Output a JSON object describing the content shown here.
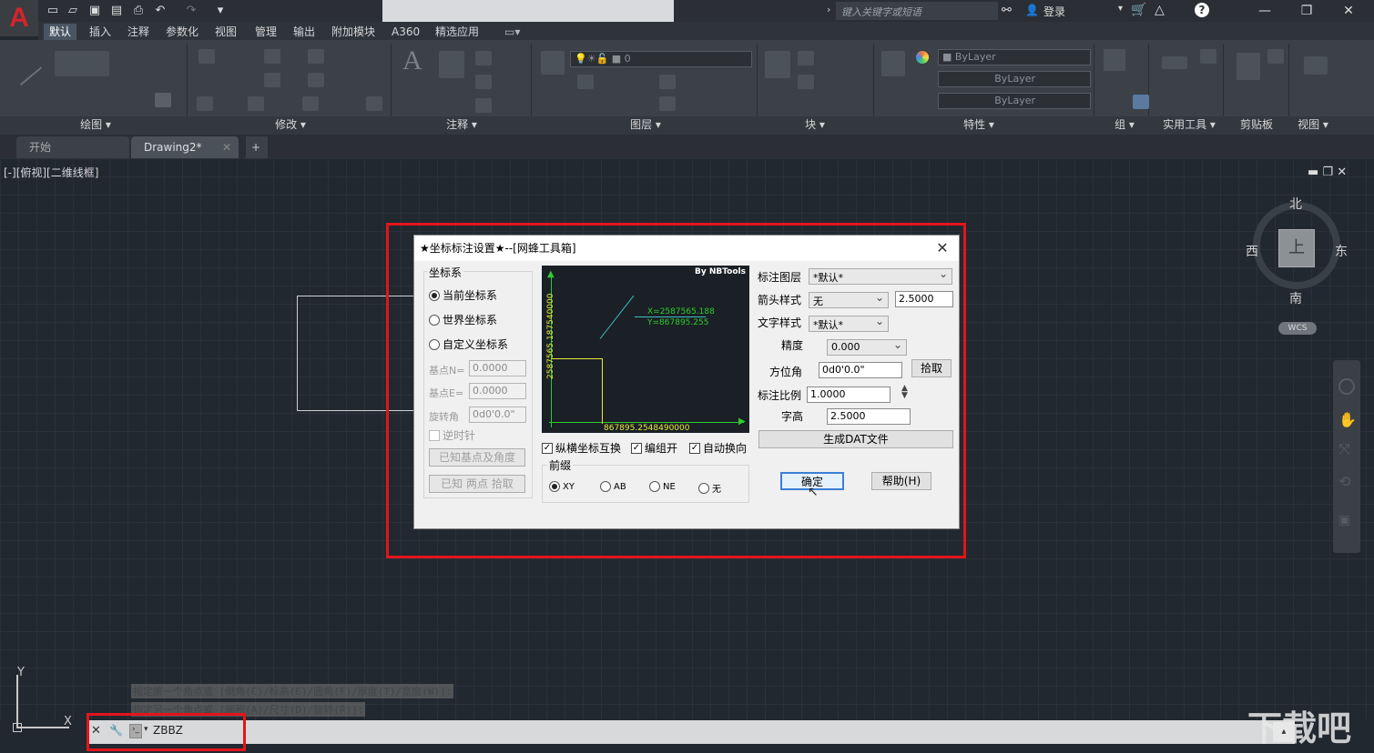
{
  "app": {
    "logo_letter": "A",
    "accent": "#d4242b"
  },
  "titlebar": {
    "search_placeholder": "键入关键字或短语",
    "login": "登录",
    "help": "?",
    "win_min": "—",
    "win_max": "❐",
    "win_close": "✕"
  },
  "menu": [
    "默认",
    "插入",
    "注释",
    "参数化",
    "视图",
    "管理",
    "输出",
    "附加模块",
    "A360",
    "精选应用"
  ],
  "ribbon": {
    "panels": [
      "绘图",
      "修改",
      "注释",
      "图层",
      "块",
      "特性",
      "组",
      "实用工具",
      "剪贴板",
      "视图"
    ],
    "layer_value": "0",
    "bylayer1": "ByLayer",
    "bylayer2": "ByLayer",
    "bylayer3": "ByLayer"
  },
  "tabs": {
    "start": "开始",
    "drawing": "Drawing2*",
    "add": "+",
    "close": "✕"
  },
  "viewport": {
    "label": "[-][俯视][二维线框]",
    "nav": {
      "north": "北",
      "south": "南",
      "east": "东",
      "west": "西",
      "top": "上",
      "wcs": "WCS"
    },
    "axis_y": "Y",
    "axis_x": "X"
  },
  "dialog": {
    "title": "★坐标标注设置★--[网蜂工具箱]",
    "close": "✕",
    "coord_group": "坐标系",
    "coord_options": [
      "当前坐标系",
      "世界坐标系",
      "自定义坐标系"
    ],
    "coord_selected": 0,
    "base_n_label": "基点N=",
    "base_n_value": "0.0000",
    "base_e_label": "基点E=",
    "base_e_value": "0.0000",
    "rotation_label": "旋转角",
    "rotation_value": "0d0'0.0\"",
    "ccw_label": "逆时针",
    "btn_known_base": "已知基点及角度",
    "btn_two_points": "已知 两点 拾取",
    "preview": {
      "credit": "By NBTools",
      "x_text": "X=2587565.188",
      "y_text": "Y=867895.255",
      "vertical_text": "2587565.187540000",
      "horizontal_text": "867895.2548490000"
    },
    "chk_swap": "纵横坐标互换",
    "chk_group": "编组开",
    "chk_autowrap": "自动换向",
    "prefix_group": "前缀",
    "prefix_options": [
      "XY",
      "AB",
      "NE",
      "无"
    ],
    "prefix_selected": 0,
    "layer_label": "标注图层",
    "layer_value": "*默认*",
    "arrow_label": "箭头样式",
    "arrow_value": "无",
    "arrow_size": "2.5000",
    "textstyle_label": "文字样式",
    "textstyle_value": "*默认*",
    "precision_label": "精度",
    "precision_value": "0.000",
    "azimuth_label": "方位角",
    "azimuth_value": "0d0'0.0\"",
    "pick_btn": "拾取",
    "scale_label": "标注比例",
    "scale_value": "1.0000",
    "height_label": "字高",
    "height_value": "2.5000",
    "gen_dat_btn": "生成DAT文件",
    "ok_btn": "确定",
    "help_btn": "帮助(H)"
  },
  "command": {
    "history1": "指定第一个角点或 [倒角(C)/标高(E)/圆角(F)/厚度(T)/宽度(W)]:",
    "history2": "指定另一个角点或 [面积(A)/尺寸(D)/旋转(R)]:",
    "input": "ZBBZ",
    "close_icon": "✕",
    "wrench_icon": "🔧"
  },
  "watermark": "下载吧"
}
